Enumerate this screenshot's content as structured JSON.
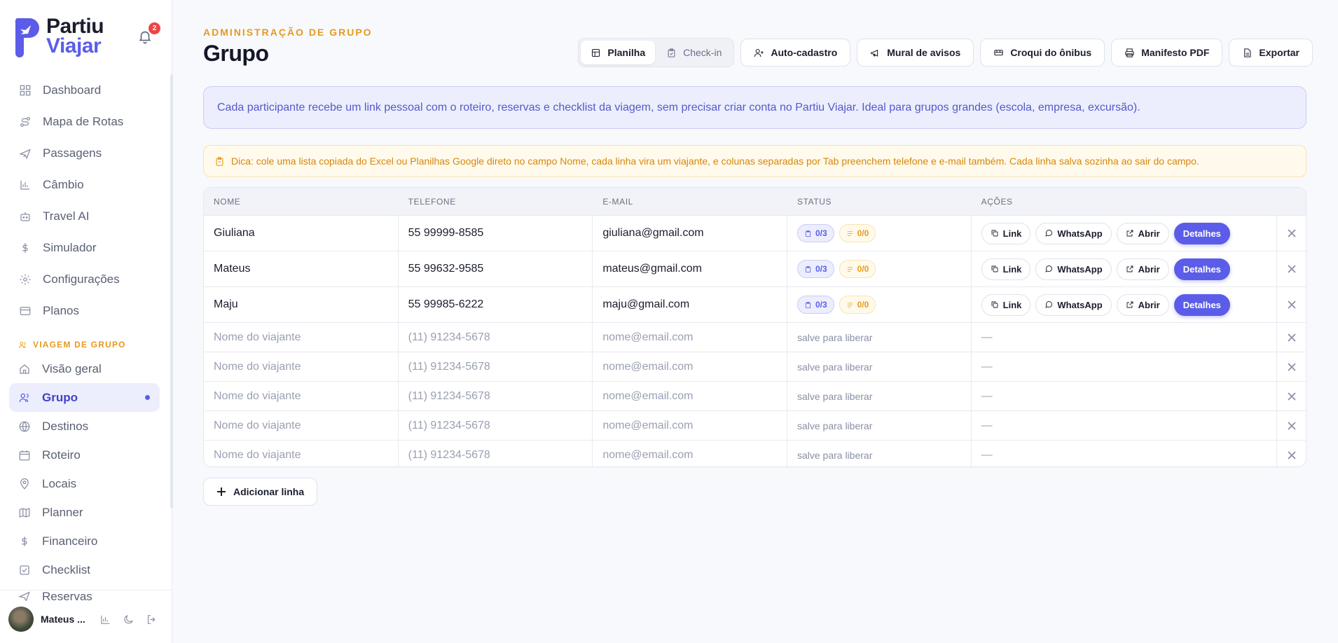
{
  "brand": {
    "line1": "Partiu",
    "line2": "Viajar",
    "notification_count": "2"
  },
  "sidebar": {
    "main_items": [
      {
        "label": "Dashboard",
        "icon": "dashboard-icon"
      },
      {
        "label": "Mapa de Rotas",
        "icon": "route-icon"
      },
      {
        "label": "Passagens",
        "icon": "plane-icon"
      },
      {
        "label": "Câmbio",
        "icon": "bar-chart-icon"
      },
      {
        "label": "Travel AI",
        "icon": "bot-icon"
      },
      {
        "label": "Simulador",
        "icon": "dollar-icon"
      },
      {
        "label": "Configurações",
        "icon": "gear-icon"
      },
      {
        "label": "Planos",
        "icon": "card-icon"
      }
    ],
    "section_label": "VIAGEM DE GRUPO",
    "group_items": [
      {
        "label": "Visão geral",
        "icon": "home-icon"
      },
      {
        "label": "Grupo",
        "icon": "users-icon",
        "active": true
      },
      {
        "label": "Destinos",
        "icon": "globe-icon"
      },
      {
        "label": "Roteiro",
        "icon": "calendar-icon"
      },
      {
        "label": "Locais",
        "icon": "pin-icon"
      },
      {
        "label": "Planner",
        "icon": "map-icon"
      },
      {
        "label": "Financeiro",
        "icon": "dollar-icon"
      },
      {
        "label": "Checklist",
        "icon": "checklist-icon"
      },
      {
        "label": "Reservas",
        "icon": "plane-icon"
      }
    ],
    "user": {
      "name": "Mateus ..."
    }
  },
  "header": {
    "eyebrow": "ADMINISTRAÇÃO DE GRUPO",
    "title": "Grupo",
    "view_toggle": {
      "planilha": "Planilha",
      "checkin": "Check-in"
    },
    "buttons": {
      "auto_cadastro": "Auto-cadastro",
      "mural": "Mural de avisos",
      "croqui": "Croqui do ônibus",
      "manifesto": "Manifesto PDF",
      "exportar": "Exportar"
    }
  },
  "info_banner": "Cada participante recebe um link pessoal com o roteiro, reservas e checklist da viagem, sem precisar criar conta no Partiu Viajar. Ideal para grupos grandes (escola, empresa, excursão).",
  "tip_banner": "Dica: cole uma lista copiada do Excel ou Planilhas Google direto no campo Nome, cada linha vira um viajante, e colunas separadas por Tab preenchem telefone e e-mail também. Cada linha salva sozinha ao sair do campo.",
  "table": {
    "headers": {
      "nome": "NOME",
      "telefone": "TELEFONE",
      "email": "E-MAIL",
      "status": "STATUS",
      "acoes": "AÇÕES"
    },
    "rows": [
      {
        "nome": "Giuliana",
        "telefone": "55 99999-8585",
        "email": "giuliana@gmail.com",
        "status_a": "0/3",
        "status_b": "0/0"
      },
      {
        "nome": "Mateus",
        "telefone": "55 99632-9585",
        "email": "mateus@gmail.com",
        "status_a": "0/3",
        "status_b": "0/0"
      },
      {
        "nome": "Maju",
        "telefone": "55 99985-6222",
        "email": "maju@gmail.com",
        "status_a": "0/3",
        "status_b": "0/0"
      }
    ],
    "actions": {
      "link": "Link",
      "whatsapp": "WhatsApp",
      "abrir": "Abrir",
      "detalhes": "Detalhes"
    },
    "empty_row": {
      "nome_placeholder": "Nome do viajante",
      "telefone_placeholder": "(11) 91234-5678",
      "email_placeholder": "nome@email.com",
      "status_text": "salve para liberar",
      "acoes_text": "—"
    }
  },
  "add_line_label": "Adicionar linha",
  "colors": {
    "accent": "#5b5de8",
    "warning": "#e69a1f",
    "danger": "#ef4444"
  }
}
